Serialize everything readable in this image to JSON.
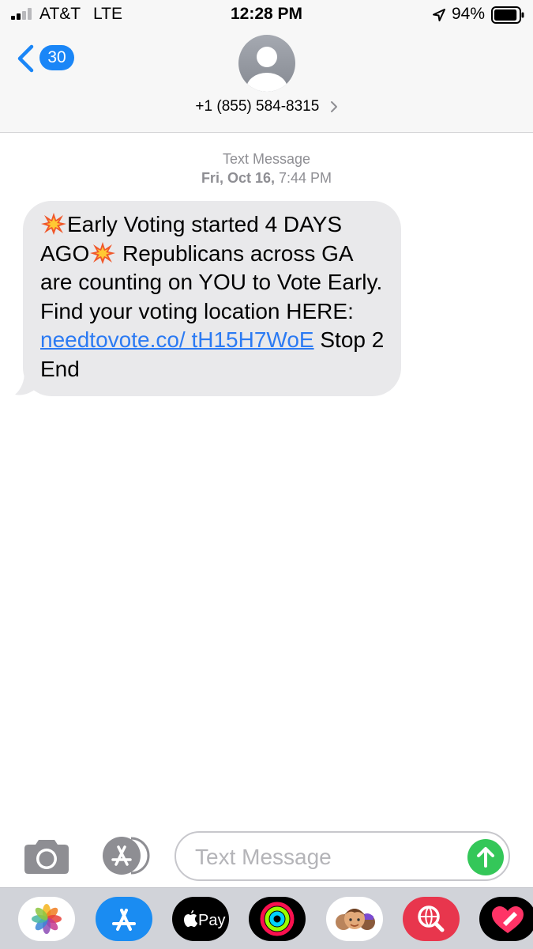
{
  "status_bar": {
    "carrier": "AT&T",
    "network": "LTE",
    "time": "12:28 PM",
    "battery": "94%",
    "battery_level": 0.94
  },
  "header": {
    "back_count": "30",
    "contact": "+1 (855) 584-8315"
  },
  "thread": {
    "message_type": "Text Message",
    "date": "Fri, Oct 16,",
    "time": "7:44 PM"
  },
  "message": {
    "text_1": "Early Voting started 4 DAYS",
    "text_2": "AGO",
    "text_3": " Republicans across GA are counting on YOU to Vote Early. Find your voting location HERE: ",
    "link": "needtovote.co/ tH15H7WoE",
    "text_4": " Stop 2 End",
    "emoji": "collision-icon"
  },
  "input": {
    "placeholder": "Text Message",
    "value": ""
  },
  "app_drawer": [
    {
      "name": "photos-icon"
    },
    {
      "name": "app-store-icon"
    },
    {
      "name": "apple-pay-icon",
      "label": "Pay"
    },
    {
      "name": "activity-icon"
    },
    {
      "name": "memoji-icon"
    },
    {
      "name": "web-search-icon"
    },
    {
      "name": "heart-sticker-icon"
    }
  ],
  "colors": {
    "accent_blue": "#1a86f7",
    "link_blue": "#2b7af3",
    "bubble_gray": "#e9e9eb",
    "send_green": "#34c759"
  }
}
